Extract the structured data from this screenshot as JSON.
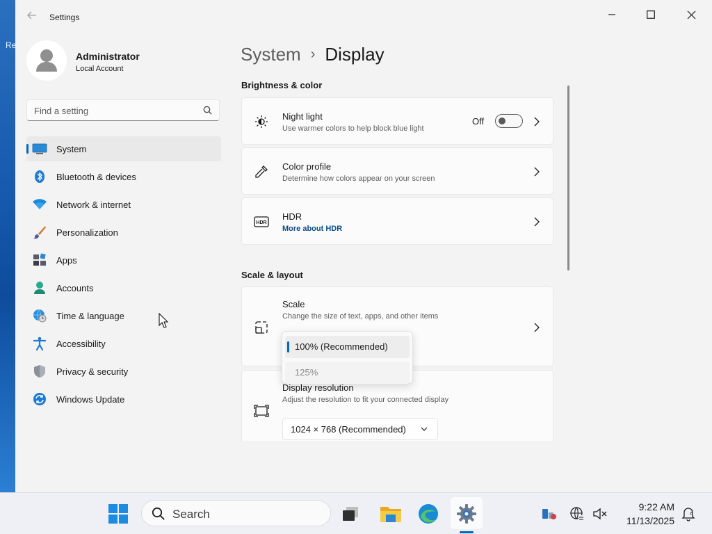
{
  "desktop": {
    "label_fragment": "Re"
  },
  "window": {
    "title": "Settings",
    "controls": {
      "minimize": "minimize",
      "maximize": "maximize",
      "close": "close"
    }
  },
  "profile": {
    "name": "Administrator",
    "account_type": "Local Account"
  },
  "search": {
    "placeholder": "Find a setting"
  },
  "nav": {
    "items": [
      {
        "label": "System",
        "icon": "system-icon",
        "selected": true
      },
      {
        "label": "Bluetooth & devices",
        "icon": "bluetooth-icon"
      },
      {
        "label": "Network & internet",
        "icon": "wifi-icon"
      },
      {
        "label": "Personalization",
        "icon": "brush-icon"
      },
      {
        "label": "Apps",
        "icon": "apps-icon"
      },
      {
        "label": "Accounts",
        "icon": "person-icon"
      },
      {
        "label": "Time & language",
        "icon": "globe-clock-icon"
      },
      {
        "label": "Accessibility",
        "icon": "accessibility-icon"
      },
      {
        "label": "Privacy & security",
        "icon": "shield-icon"
      },
      {
        "label": "Windows Update",
        "icon": "update-icon"
      }
    ]
  },
  "breadcrumb": {
    "parent": "System",
    "separator": "›",
    "current": "Display"
  },
  "sections": {
    "brightness": {
      "title": "Brightness & color",
      "night_light": {
        "title": "Night light",
        "subtitle": "Use warmer colors to help block blue light",
        "state_label": "Off",
        "on": false
      },
      "color_profile": {
        "title": "Color profile",
        "subtitle": "Determine how colors appear on your screen"
      },
      "hdr": {
        "title": "HDR",
        "link": "More about HDR"
      }
    },
    "scale_layout": {
      "title": "Scale & layout",
      "scale": {
        "title": "Scale",
        "subtitle": "Change the size of text, apps, and other items",
        "options": [
          "100% (Recommended)",
          "125%"
        ],
        "selected": "100% (Recommended)"
      },
      "resolution": {
        "title": "Display resolution",
        "subtitle": "Adjust the resolution to fit your connected display",
        "value": "1024 × 768 (Recommended)"
      }
    }
  },
  "taskbar": {
    "search_label": "Search",
    "clock": {
      "time": "9:22 AM",
      "date": "11/13/2025"
    }
  },
  "colors": {
    "accent": "#0067c0",
    "window_bg": "#f3f3f3",
    "card_bg": "#fbfbfb",
    "link": "#0f4b8a"
  }
}
